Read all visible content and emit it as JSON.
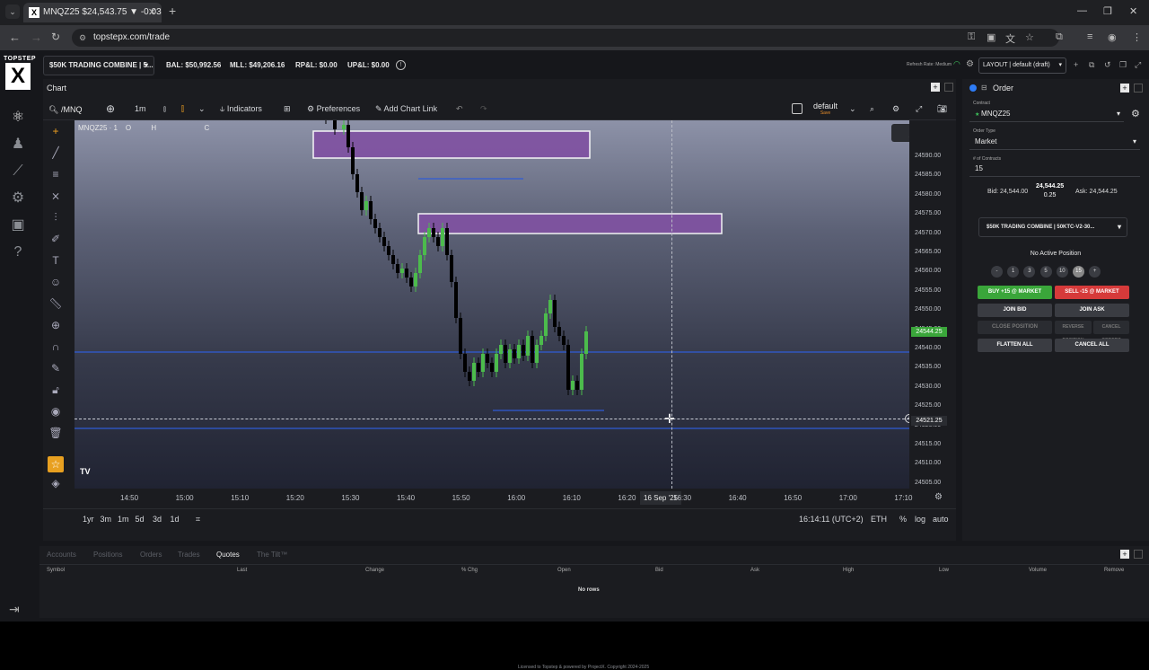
{
  "browser": {
    "tab_title": "MNQZ25 $24,543.75 ▼ -0.03%",
    "favicon": "X",
    "url": "topstepx.com/trade"
  },
  "app": {
    "logo_text": "TOPSTEP",
    "logo_mark": "X",
    "version": "Version: 1.21.1",
    "license": "Licensed to Topstep & powered by ProjectX. Copyright 2024-2025"
  },
  "topbar": {
    "account": "$50K TRADING COMBINE | 5...",
    "bal": "BAL: $50,992.56",
    "mll": "MLL: $49,206.16",
    "rpl": "RP&L: $0.00",
    "upl": "UP&L: $0.00",
    "refresh_rate": "Refresh Rate: Medium",
    "layout": "LAYOUT | default (draft)"
  },
  "chart": {
    "panel_title": "Chart",
    "symbol": "/MNQ",
    "interval": "1m",
    "indicators": "Indicators",
    "preferences": "Preferences",
    "add_chart_link": "Add Chart Link",
    "template_name": "default",
    "template_save": "Save",
    "legend_symbol": "MNQZ25 · 1",
    "legend_o": "O",
    "legend_h": "H",
    "legend_c": "C",
    "crosshair_date": "16 Sep '25",
    "crosshair_price": "24521.25",
    "last_price": "24544.25",
    "time_label": "16:14:11 (UTC+2)",
    "session": "ETH",
    "pct": "%",
    "log": "log",
    "auto": "auto",
    "ranges": [
      "1yr",
      "3m",
      "1m",
      "5d",
      "3d",
      "1d"
    ],
    "price_ticks": [
      "24590.00",
      "24585.00",
      "24580.00",
      "24575.00",
      "24570.00",
      "24565.00",
      "24560.00",
      "24555.00",
      "24550.00",
      "24545.00",
      "24540.00",
      "24535.00",
      "24530.00",
      "24525.00",
      "24520.00",
      "24515.00",
      "24510.00",
      "24505.00"
    ],
    "time_ticks": [
      "14:50",
      "15:00",
      "15:10",
      "15:20",
      "15:30",
      "15:40",
      "15:50",
      "16:00",
      "16:10",
      "16:20",
      "16:30",
      "16:40",
      "16:50",
      "17:00",
      "17:10"
    ],
    "colors": {
      "up": "#4cbb4c",
      "down": "#000000",
      "zone": "#8052a2",
      "line": "#2f5bd6"
    }
  },
  "order": {
    "title": "Order",
    "contract_label": "Contract",
    "contract": "MNQZ25",
    "type_label": "Order Type",
    "type": "Market",
    "qty_label": "# of Contracts",
    "qty": "15",
    "bid": "Bid: 24,544.00",
    "mid_price": "24,544.25",
    "spread": "0.25",
    "ask": "Ask: 24,544.25",
    "account": "$50K TRADING COMBINE | 50KTC-V2-30...",
    "no_position": "No Active Position",
    "qty_buttons": [
      "-",
      "1",
      "3",
      "5",
      "10",
      "15",
      "+"
    ],
    "buy": "BUY +15 @ MARKET",
    "sell": "SELL -15 @ MARKET",
    "join_bid": "JOIN BID",
    "join_ask": "JOIN ASK",
    "close_position": "CLOSE POSITION",
    "reverse_position": "REVERSE POSITION",
    "cancel_orders": "CANCEL ORDERS",
    "flatten_all": "FLATTEN ALL",
    "cancel_all": "CANCEL ALL"
  },
  "bottom": {
    "tabs": [
      "Accounts",
      "Positions",
      "Orders",
      "Trades",
      "Quotes",
      "The Tilt™"
    ],
    "active_tab": "Quotes",
    "columns": [
      "Symbol",
      "Last",
      "Change",
      "% Chg",
      "Open",
      "Bid",
      "Ask",
      "High",
      "Low",
      "Volume",
      "Remove"
    ],
    "empty": "No rows"
  }
}
